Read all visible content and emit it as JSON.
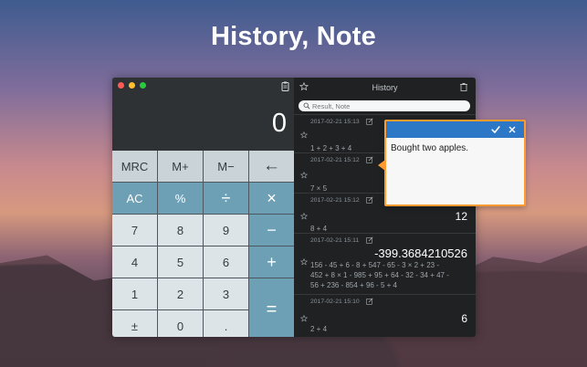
{
  "headline": "History, Note",
  "display": {
    "value": "0"
  },
  "keypad": {
    "keys": [
      "MRC",
      "M+",
      "M−",
      "←",
      "AC",
      "%",
      "÷",
      "×",
      "7",
      "8",
      "9",
      "−",
      "4",
      "5",
      "6",
      "+",
      "1",
      "2",
      "3",
      "=",
      "±",
      "0",
      "."
    ]
  },
  "history": {
    "title": "History",
    "search": {
      "placeholder": "Result, Note"
    },
    "entries": [
      {
        "timestamp": "2017-02-21 15:13",
        "result": "",
        "expression": [
          "1 + 2 + 3 + 4"
        ]
      },
      {
        "timestamp": "2017-02-21 15:12",
        "result": "",
        "expression": [
          "7 × 5"
        ]
      },
      {
        "timestamp": "2017-02-21 15:12",
        "result": "12",
        "expression": [
          "8 + 4"
        ]
      },
      {
        "timestamp": "2017-02-21 15:11",
        "result": "-399.3684210526",
        "expression": [
          "156 - 45 + 6 - 8 + 547 - 65 - 3 × 2 + 23 -",
          "452 + 8 × 1 - 985 + 95 + 64 - 32 - 34 + 47 -",
          "56 + 236 - 854 + 96 - 5 + 4"
        ]
      },
      {
        "timestamp": "2017-02-21 15:10",
        "result": "6",
        "expression": [
          "2 + 4"
        ]
      }
    ]
  },
  "note": {
    "text": "Bought two apples."
  },
  "colors": {
    "accent": "#6d9fb5",
    "popup_border": "#ff9b2f",
    "popup_bar": "#2c78c6"
  },
  "icons": [
    "clipboard-icon",
    "star-icon",
    "trash-icon",
    "search-icon",
    "note-edit-icon",
    "checkmark-icon",
    "close-icon"
  ]
}
